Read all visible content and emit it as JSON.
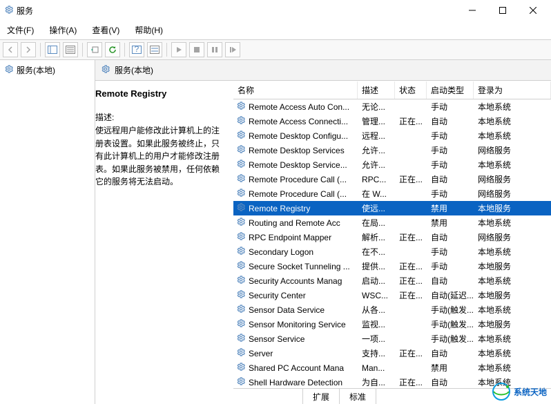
{
  "window": {
    "title": "服务"
  },
  "menu": {
    "file": "文件(F)",
    "action": "操作(A)",
    "view": "查看(V)",
    "help": "帮助(H)"
  },
  "tree": {
    "root": "服务(本地)"
  },
  "rightHeader": {
    "label": "服务(本地)"
  },
  "detail": {
    "title": "Remote Registry",
    "descLabel": "描述:",
    "desc": "使远程用户能修改此计算机上的注册表设置。如果此服务被终止，只有此计算机上的用户才能修改注册表。如果此服务被禁用，任何依赖它的服务将无法启动。"
  },
  "columns": {
    "name": "名称",
    "desc": "描述",
    "status": "状态",
    "start": "启动类型",
    "logon": "登录为"
  },
  "services": [
    {
      "name": "Remote Access Auto Con...",
      "desc": "无论...",
      "status": "",
      "start": "手动",
      "logon": "本地系统"
    },
    {
      "name": "Remote Access Connecti...",
      "desc": "管理...",
      "status": "正在...",
      "start": "自动",
      "logon": "本地系统"
    },
    {
      "name": "Remote Desktop Configu...",
      "desc": "远程...",
      "status": "",
      "start": "手动",
      "logon": "本地系统"
    },
    {
      "name": "Remote Desktop Services",
      "desc": "允许...",
      "status": "",
      "start": "手动",
      "logon": "网络服务"
    },
    {
      "name": "Remote Desktop Service...",
      "desc": "允许...",
      "status": "",
      "start": "手动",
      "logon": "本地系统"
    },
    {
      "name": "Remote Procedure Call (...",
      "desc": "RPC...",
      "status": "正在...",
      "start": "自动",
      "logon": "网络服务"
    },
    {
      "name": "Remote Procedure Call (...",
      "desc": "在 W...",
      "status": "",
      "start": "手动",
      "logon": "网络服务"
    },
    {
      "name": "Remote Registry",
      "desc": "使远...",
      "status": "",
      "start": "禁用",
      "logon": "本地服务",
      "selected": true
    },
    {
      "name": "Routing and Remote Acc",
      "desc": "在局...",
      "status": "",
      "start": "禁用",
      "logon": "本地系统"
    },
    {
      "name": "RPC Endpoint Mapper",
      "desc": "解析...",
      "status": "正在...",
      "start": "自动",
      "logon": "网络服务"
    },
    {
      "name": "Secondary Logon",
      "desc": "在不...",
      "status": "",
      "start": "手动",
      "logon": "本地系统"
    },
    {
      "name": "Secure Socket Tunneling ...",
      "desc": "提供...",
      "status": "正在...",
      "start": "手动",
      "logon": "本地服务"
    },
    {
      "name": "Security Accounts Manag",
      "desc": "启动...",
      "status": "正在...",
      "start": "自动",
      "logon": "本地系统"
    },
    {
      "name": "Security Center",
      "desc": "WSC...",
      "status": "正在...",
      "start": "自动(延迟...",
      "logon": "本地服务"
    },
    {
      "name": "Sensor Data Service",
      "desc": "从各...",
      "status": "",
      "start": "手动(触发...",
      "logon": "本地系统"
    },
    {
      "name": "Sensor Monitoring Service",
      "desc": "监视...",
      "status": "",
      "start": "手动(触发...",
      "logon": "本地服务"
    },
    {
      "name": "Sensor Service",
      "desc": "一项...",
      "status": "",
      "start": "手动(触发...",
      "logon": "本地系统"
    },
    {
      "name": "Server",
      "desc": "支持...",
      "status": "正在...",
      "start": "自动",
      "logon": "本地系统"
    },
    {
      "name": "Shared PC Account Mana",
      "desc": "Man...",
      "status": "",
      "start": "禁用",
      "logon": "本地系统"
    },
    {
      "name": "Shell Hardware Detection",
      "desc": "为自...",
      "status": "正在...",
      "start": "自动",
      "logon": "本地系统"
    }
  ],
  "tabs": {
    "extended": "扩展",
    "standard": "标准"
  },
  "brand": {
    "text": "系统天地"
  }
}
